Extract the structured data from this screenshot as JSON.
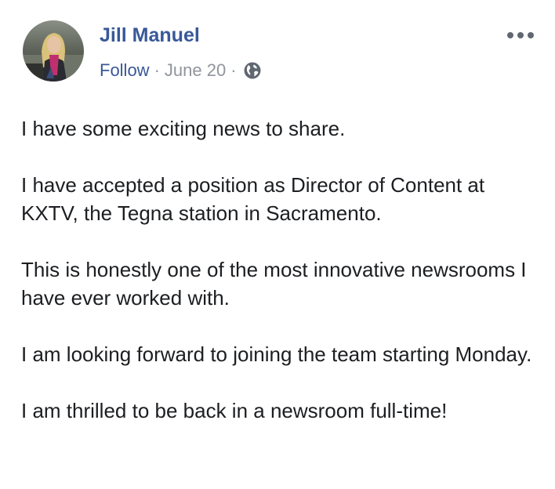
{
  "post": {
    "author": "Jill Manuel",
    "follow_label": "Follow",
    "separator": "·",
    "date": "June 20",
    "privacy_icon": "globe-icon",
    "more_icon": "more-options-icon",
    "paragraphs": [
      "I have some exciting news to share.",
      "I have accepted a position as Director of Content at KXTV, the Tegna station in Sacramento.",
      "This is honestly one of the most innovative newsrooms I have ever worked with.",
      "I am looking forward to joining the team starting Monday.",
      "I am thrilled to be back in a newsroom full-time!"
    ]
  },
  "colors": {
    "link": "#385898",
    "meta": "#90949c",
    "text": "#1c1e21",
    "more_dots": "#606770"
  }
}
